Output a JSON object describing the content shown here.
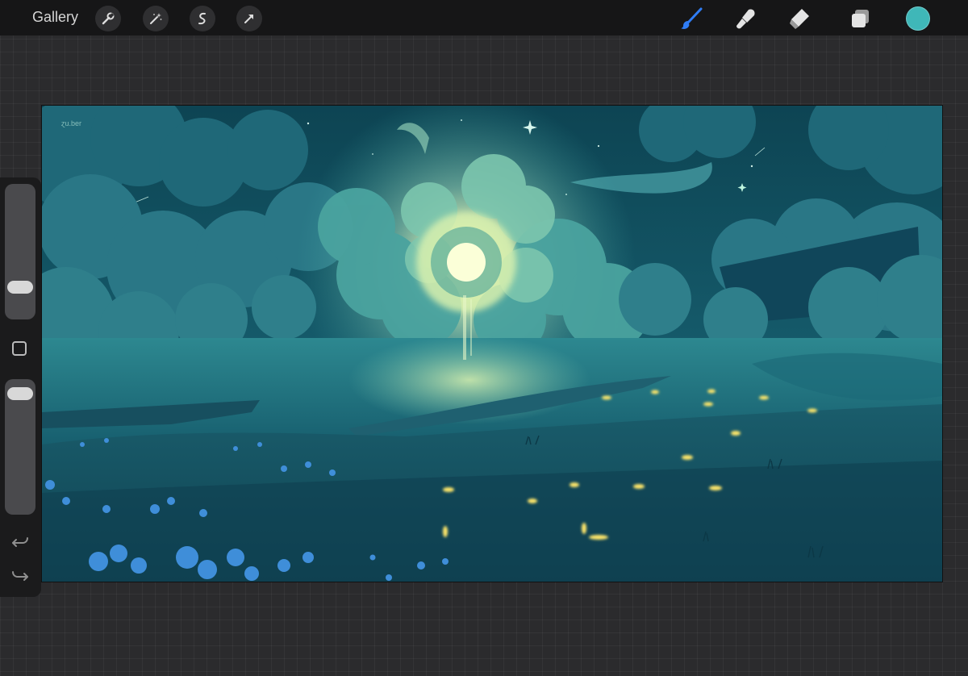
{
  "toolbar": {
    "gallery_label": "Gallery",
    "left_tools": [
      "wrench-icon",
      "magic-wand-icon",
      "selection-icon",
      "transform-arrow-icon"
    ],
    "right_tools": [
      "brush-icon",
      "smudge-icon",
      "eraser-icon",
      "layers-icon"
    ],
    "active_tool": "brush-icon",
    "active_tool_color": "#2f7df6",
    "current_color": "#3fb7b8"
  },
  "canvas": {
    "watermark": "ɀu.ber"
  },
  "sidebar": {
    "brush_size": 0.2,
    "opacity": 0.95,
    "icons": [
      "modify-square-icon",
      "undo-icon",
      "redo-icon"
    ]
  }
}
